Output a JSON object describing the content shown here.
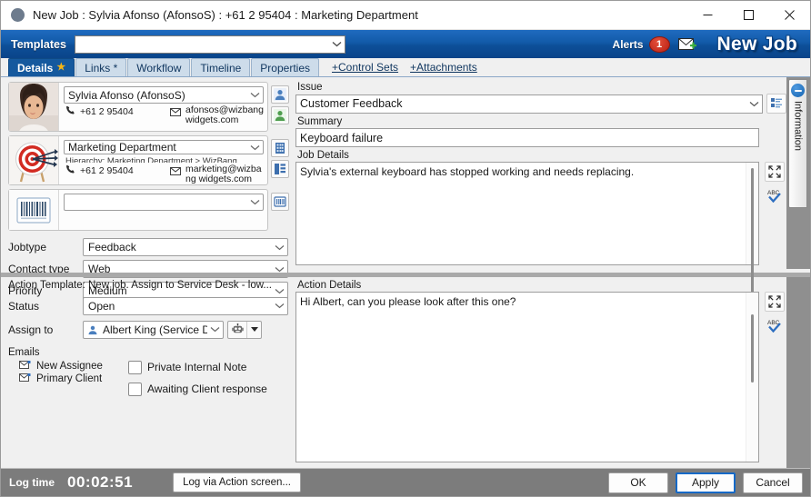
{
  "window": {
    "title": "New Job : Sylvia Afonso (AfonsoS) : +61 2 95404 : Marketing Department",
    "minimize_label": "Minimize",
    "maximize_label": "Maximize",
    "close_label": "Close"
  },
  "header": {
    "templates_label": "Templates",
    "templates_value": "",
    "alerts_label": "Alerts",
    "alerts_count": "1",
    "mail_icon": "new-mail-icon",
    "screen_title": "New Job",
    "accent_blue": "#125aa8"
  },
  "tabs": {
    "items": [
      {
        "label": "Details",
        "active": true,
        "starred": true
      },
      {
        "label": "Links *",
        "active": false,
        "starred": false
      },
      {
        "label": "Workflow",
        "active": false,
        "starred": false
      },
      {
        "label": "Timeline",
        "active": false,
        "starred": false
      },
      {
        "label": "Properties",
        "active": false,
        "starred": false
      }
    ],
    "links": [
      {
        "label": "+Control Sets"
      },
      {
        "label": "+Attachments"
      }
    ]
  },
  "contact_card": {
    "avatar": "person-photo",
    "name": "Sylvia Afonso (AfonsoS)",
    "phone": "+61 2 95404",
    "email": "afonsos@wizbangwidgets.com",
    "phone_icon": "phone-icon",
    "email_icon": "envelope-icon",
    "buttons": [
      {
        "icon": "person-blue-icon"
      },
      {
        "icon": "person-green-icon"
      }
    ]
  },
  "org_card": {
    "avatar": "target-icon",
    "name": "Marketing Department",
    "hierarchy": "Hierarchy: Marketing Department > WizBang",
    "phone": "+61 2 95404",
    "email": "marketing@wizbang widgets.com",
    "buttons": [
      {
        "icon": "building-icon"
      },
      {
        "icon": "org-chart-icon"
      }
    ]
  },
  "asset_card": {
    "avatar": "barcode-icon",
    "value": "",
    "buttons": [
      {
        "icon": "barcode-scan-icon"
      }
    ]
  },
  "fields": [
    {
      "label": "Jobtype",
      "value": "Feedback"
    },
    {
      "label": "Contact type",
      "value": "Web"
    },
    {
      "label": "Priority",
      "value": "Medium"
    }
  ],
  "issue": {
    "label": "Issue",
    "value": "Customer Feedback",
    "button_icon": "issue-list-icon"
  },
  "summary": {
    "label": "Summary",
    "value": "Keyboard failure"
  },
  "job_details": {
    "label": "Job Details",
    "value": "Sylvia's external keyboard has stopped working and needs replacing.",
    "expand_icon": "expand-icon",
    "spellcheck_icon": "spellcheck-abc-icon"
  },
  "action": {
    "template_text": "Action Template: New job.  Assign to Service Desk - low...",
    "status_label": "Status",
    "status_value": "Open",
    "assign_label": "Assign to",
    "assign_value": "Albert King (Service De",
    "assign_person_icon": "person-blue-icon",
    "robot_icon": "robot-icon",
    "robot_dropdown_icon": "caret-down-icon",
    "emails_label": "Emails",
    "emails": [
      {
        "label": "New Assignee",
        "icon": "email-send-icon"
      },
      {
        "label": "Primary Client",
        "icon": "email-send-icon"
      }
    ],
    "checkboxes": [
      {
        "label": "Private Internal Note",
        "checked": false
      },
      {
        "label": "Awaiting Client response",
        "checked": false
      }
    ]
  },
  "action_details": {
    "label": "Action Details",
    "value": "Hi Albert, can you please look after this one?",
    "expand_icon": "expand-icon",
    "spellcheck_icon": "spellcheck-abc-icon"
  },
  "information_panel": {
    "label": "Information",
    "icon": "info-circle-icon"
  },
  "statusbar": {
    "logtime_label": "Log time",
    "logtime_value": "00:02:51",
    "log_action_button": "Log via Action screen...",
    "ok_button": "OK",
    "apply_button": "Apply",
    "cancel_button": "Cancel"
  }
}
